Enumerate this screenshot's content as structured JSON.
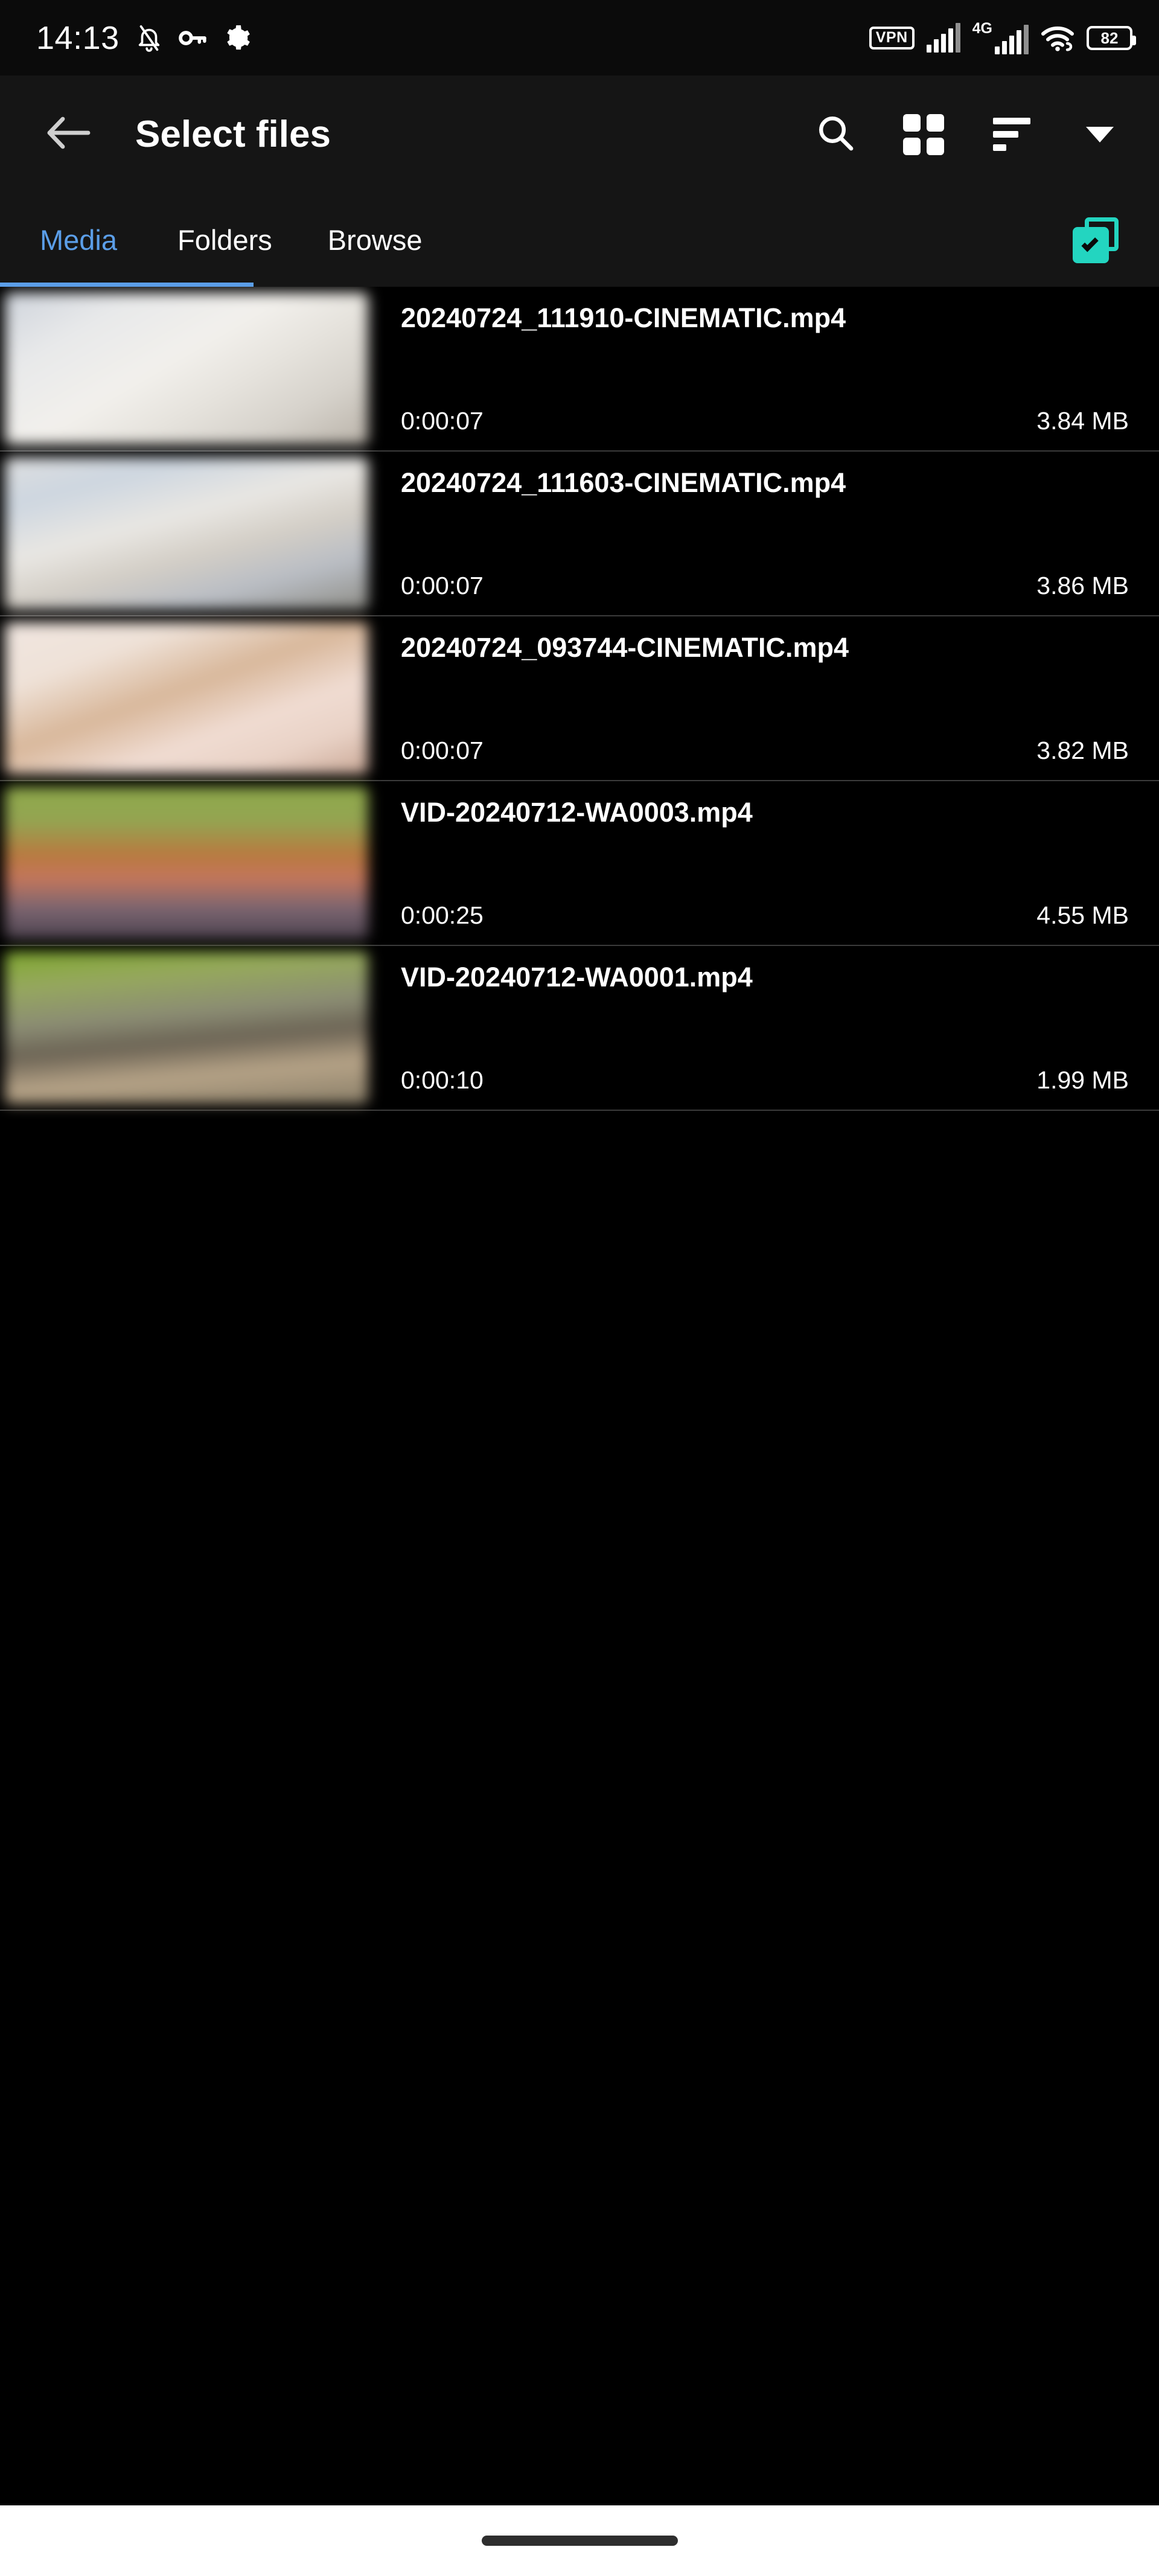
{
  "status_bar": {
    "time": "14:13",
    "icons_left": [
      "bell-slash-icon",
      "key-icon",
      "gear-icon"
    ],
    "vpn_label": "VPN",
    "network_label": "4G",
    "battery_level": "82",
    "icons_right": [
      "vpn-badge",
      "signal-bars-icon",
      "4g-signal-icon",
      "wifi-icon",
      "battery-icon"
    ]
  },
  "app_bar": {
    "back_icon": "arrow-left-icon",
    "title": "Select files",
    "actions": [
      {
        "name": "search-button",
        "icon": "search-icon"
      },
      {
        "name": "grid-view-button",
        "icon": "grid-view-icon"
      },
      {
        "name": "sort-button",
        "icon": "sort-icon"
      },
      {
        "name": "overflow-dropdown-button",
        "icon": "chevron-down-icon"
      }
    ]
  },
  "tabs": {
    "items": [
      {
        "label": "Media",
        "active": true
      },
      {
        "label": "Folders",
        "active": false
      },
      {
        "label": "Browse",
        "active": false
      }
    ],
    "active_color": "#5b9ee8",
    "select_all": {
      "name": "select-all-button",
      "icon": "select-all-icon",
      "color": "#23d5c0"
    }
  },
  "files": [
    {
      "name": "20240724_111910-CINEMATIC.mp4",
      "duration": "0:00:07",
      "size": "3.84 MB",
      "thumb": "linear-gradient(150deg,#cfd4dc 0%,#e8e9ea 22%,#f2f0ec 45%,#e6e3dd 62%,#d6d2cb 80%,#b9b2a8 100%)"
    },
    {
      "name": "20240724_111603-CINEMATIC.mp4",
      "duration": "0:00:07",
      "size": "3.86 MB",
      "thumb": "linear-gradient(165deg,#dedfe0 0%,#cdd6e0 20%,#e9e7e3 42%,#d3cec6 60%,#b9bdc4 78%,#8e8d86 100%)"
    },
    {
      "name": "20240724_093744-CINEMATIC.mp4",
      "duration": "0:00:07",
      "size": "3.82 MB",
      "thumb": "linear-gradient(160deg,#f0e6e0 0%,#efe2d8 24%,#d8b79a 46%,#f0dcd2 66%,#e9d2c6 82%,#caa896 100%)"
    },
    {
      "name": "VID-20240712-WA0003.mp4",
      "duration": "0:00:25",
      "size": "4.55 MB",
      "thumb": "linear-gradient(180deg,#8fa94a 0%,#93a552 22%,#b9793f 45%,#c4765c 60%,#7a6470 80%,#4e4450 100%)"
    },
    {
      "name": "VID-20240712-WA0001.mp4",
      "duration": "0:00:10",
      "size": "1.99 MB",
      "thumb": "linear-gradient(175deg,#7fa82e 0%,#96a85e 20%,#8b8c74 42%,#6b6354 58%,#b6a387 76%,#8a7f69 100%)"
    }
  ],
  "nav_bar": {
    "gesture_pill": "home-gesture-pill"
  }
}
